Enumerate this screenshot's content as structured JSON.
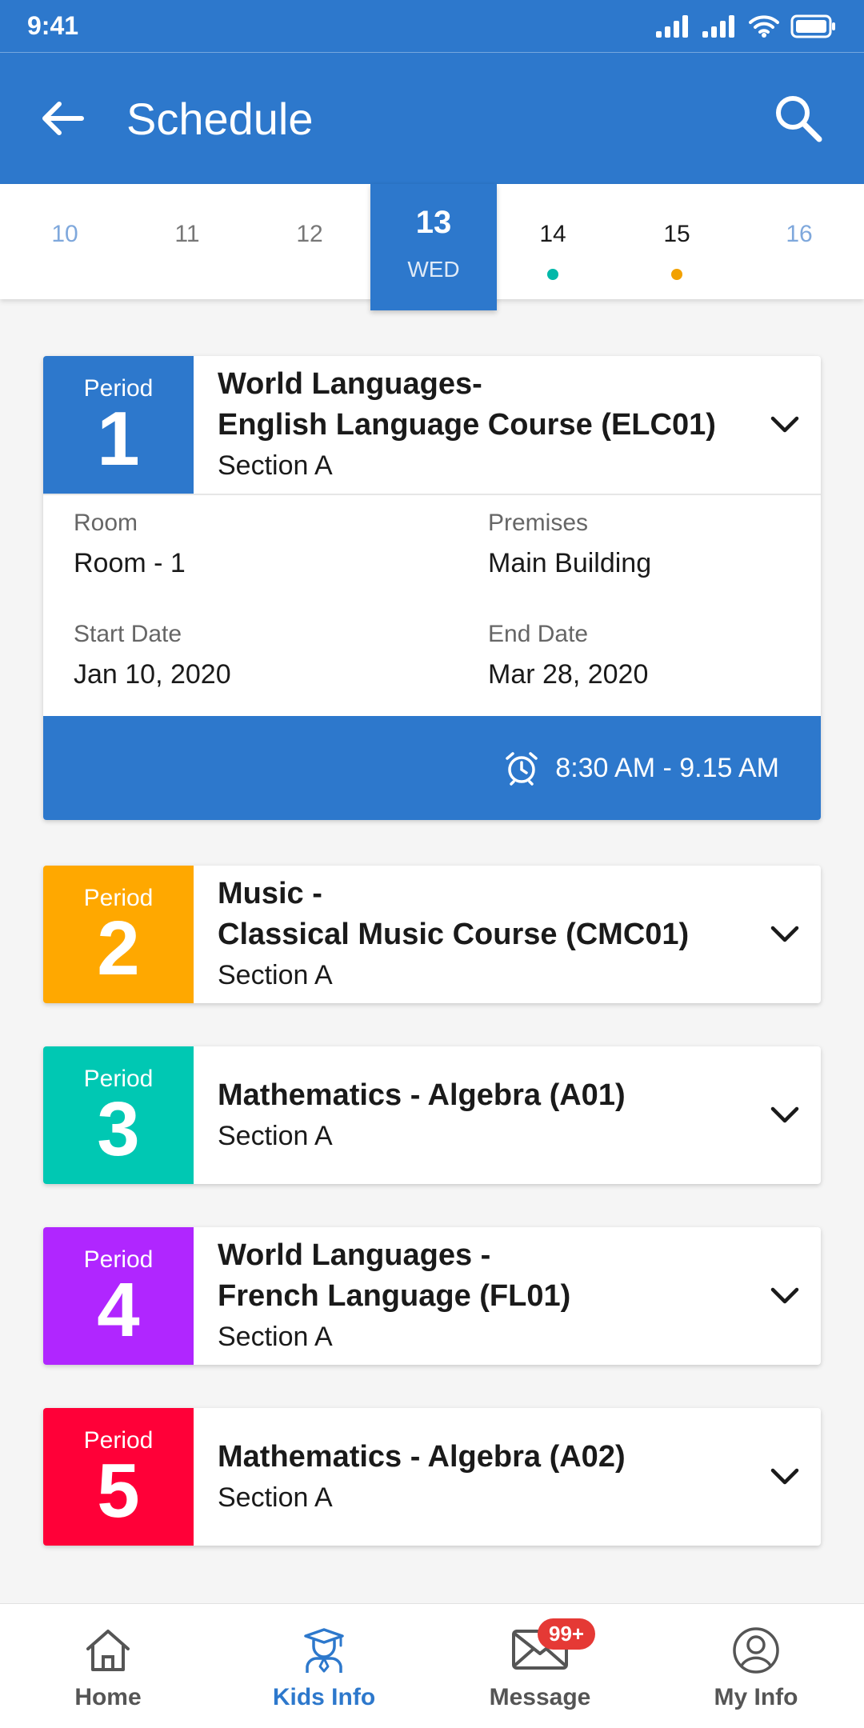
{
  "status_bar": {
    "time": "9:41"
  },
  "app_bar": {
    "title": "Schedule"
  },
  "dates": [
    {
      "num": "10",
      "day": "",
      "dot_color": ""
    },
    {
      "num": "11",
      "day": "",
      "dot_color": ""
    },
    {
      "num": "12",
      "day": "",
      "dot_color": ""
    },
    {
      "num": "13",
      "day": "WED",
      "dot_color": ""
    },
    {
      "num": "14",
      "day": "",
      "dot_color": "#00b8a9"
    },
    {
      "num": "15",
      "day": "",
      "dot_color": "#f2a100"
    },
    {
      "num": "16",
      "day": "",
      "dot_color": ""
    }
  ],
  "periods": [
    {
      "label": "Period",
      "number": "1",
      "color": "#2d78cc",
      "title": "World Languages-\nEnglish Language Course (ELC01)",
      "section": "Section A",
      "expanded": true,
      "details": {
        "room_label": "Room",
        "room": "Room - 1",
        "premises_label": "Premises",
        "premises": "Main Building",
        "start_label": "Start Date",
        "start": "Jan 10, 2020",
        "end_label": "End Date",
        "end": "Mar 28, 2020",
        "time": "8:30 AM - 9.15 AM"
      }
    },
    {
      "label": "Period",
      "number": "2",
      "color": "#ffa800",
      "title": "Music -\nClassical Music Course (CMC01)",
      "section": "Section A",
      "expanded": false
    },
    {
      "label": "Period",
      "number": "3",
      "color": "#00c8b3",
      "title": "Mathematics - Algebra (A01)",
      "section": "Section A",
      "expanded": false
    },
    {
      "label": "Period",
      "number": "4",
      "color": "#b026ff",
      "title": "World Languages -\nFrench Language (FL01)",
      "section": "Section A",
      "expanded": false
    },
    {
      "label": "Period",
      "number": "5",
      "color": "#ff0038",
      "title": "Mathematics - Algebra (A02)",
      "section": "Section A",
      "expanded": false
    }
  ],
  "bottom_nav": {
    "items": [
      {
        "label": "Home",
        "icon": "home-icon",
        "active": false
      },
      {
        "label": "Kids Info",
        "icon": "graduate-icon",
        "active": true
      },
      {
        "label": "Message",
        "icon": "mail-icon",
        "active": false
      },
      {
        "label": "My Info",
        "icon": "user-icon",
        "active": false
      }
    ],
    "message_badge": "99+"
  },
  "colors": {
    "primary": "#2d78cc",
    "date_past": "#7fa8dc",
    "date_future": "#7fa8dc"
  }
}
